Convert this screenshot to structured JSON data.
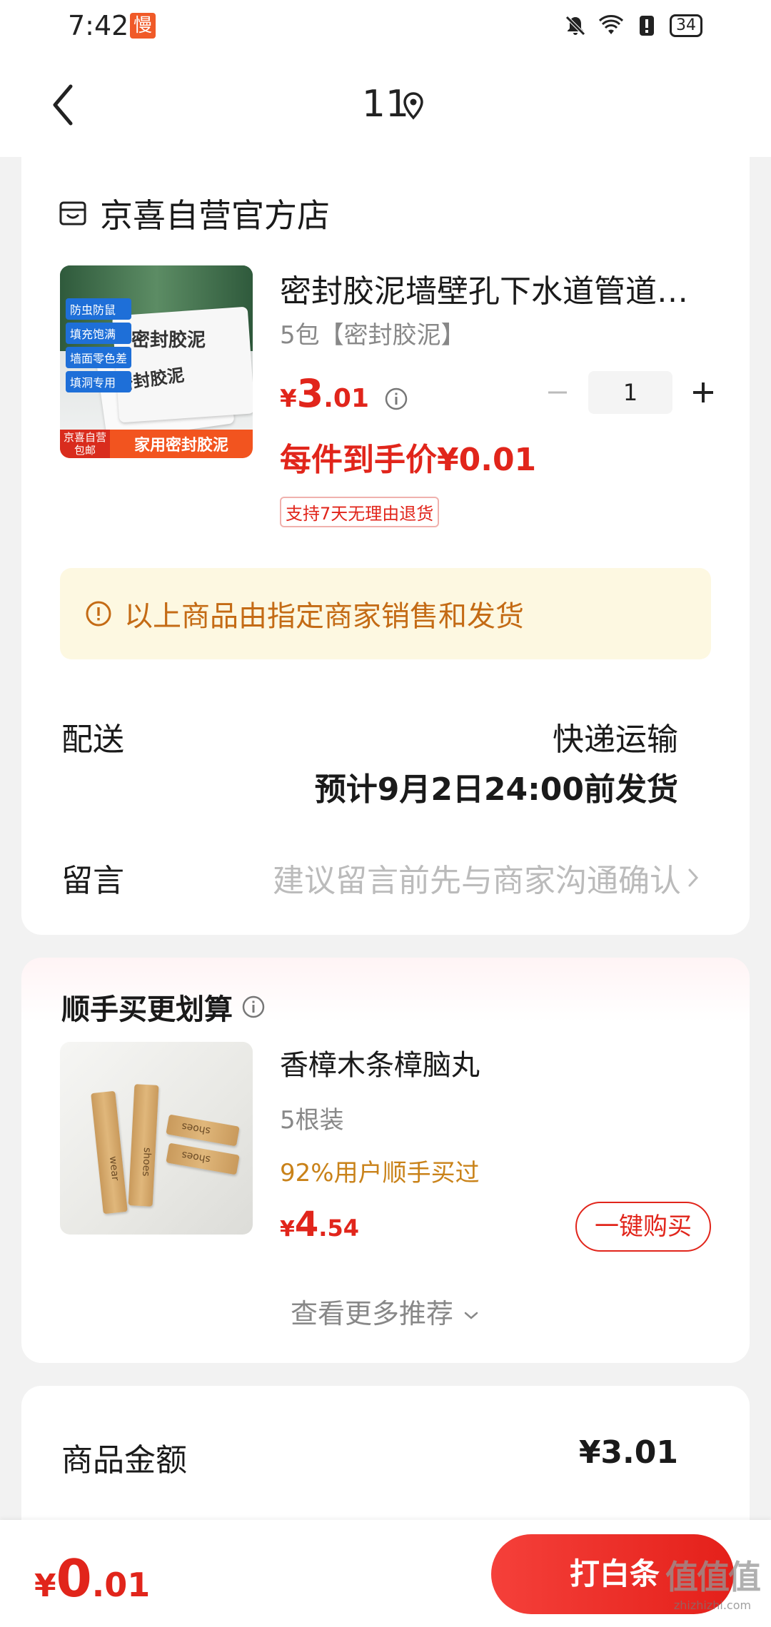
{
  "status_bar": {
    "time": "7:42",
    "slow_badge": "慢",
    "battery": "34"
  },
  "nav": {
    "title": "11"
  },
  "store": {
    "name": "京喜自营官方店"
  },
  "product": {
    "image_tags": [
      "防虫防鼠",
      "填充饱满",
      "墙面零色差",
      "填洞专用"
    ],
    "image_pack_title": "密封胶泥",
    "image_badge_top": "京喜自营",
    "image_badge_bottom": "包邮",
    "image_banner": "家用密封胶泥",
    "name": "密封胶泥墙壁孔下水道管道空调洞堵漏封堵胶泥",
    "spec": "5包【密封胶泥】",
    "price_currency": "¥",
    "price_int": "3",
    "price_dec": ".01",
    "quantity": "1",
    "per_item_price": "每件到手价¥0.01",
    "return_policy": "支持7天无理由退货"
  },
  "notice": {
    "text": "以上商品由指定商家销售和发货"
  },
  "shipping": {
    "label": "配送",
    "method": "快递运输",
    "eta": "预计9月2日24:00前发货"
  },
  "message": {
    "label": "留言",
    "placeholder": "建议留言前先与商家沟通确认"
  },
  "recommend": {
    "title": "顺手买更划算",
    "item_name": "香樟木条樟脑丸",
    "item_spec": "5根装",
    "item_users": "92%用户顺手买过",
    "price_currency": "¥",
    "price_int": "4",
    "price_dec": ".54",
    "buy_label": "一键购买",
    "more_label": "查看更多推荐",
    "image_words": [
      "wear",
      "shoes",
      "shoes",
      "shoes"
    ]
  },
  "summary": {
    "goods_amount_label": "商品金额",
    "goods_amount_value": "¥3.01"
  },
  "bottom": {
    "total_currency": "¥",
    "total_int": "0",
    "total_dec": ".01",
    "pay_label": "打白条",
    "watermark_logo": "值值值",
    "watermark_url": "zhizhizhi.com"
  },
  "colors": {
    "accent": "#e1251b",
    "notice_bg": "#fdf8e1",
    "notice_text": "#c46b15",
    "users_text": "#c98219"
  }
}
